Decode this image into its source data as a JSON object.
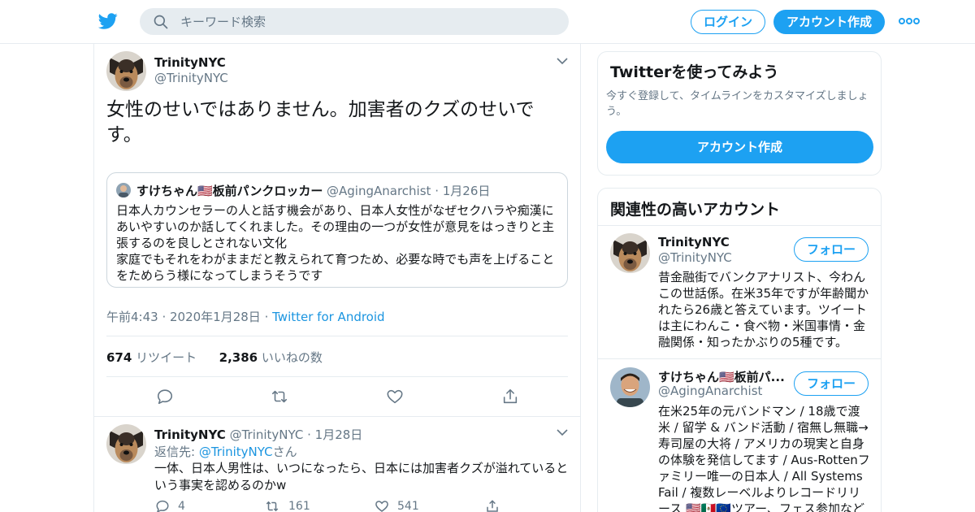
{
  "header": {
    "search_placeholder": "キーワード検索",
    "login_label": "ログイン",
    "signup_label": "アカウント作成"
  },
  "tweet": {
    "author_name": "TrinityNYC",
    "author_handle": "@TrinityNYC",
    "text": "女性のせいではありません。加害者のクズのせいです。",
    "quote": {
      "author_name": "すけちゃん🇺🇸板前パンクロッカー",
      "author_handle": "@AgingAnarchist",
      "date": "1月26日",
      "text_line1": "日本人カウンセラーの人と話す機会があり、日本人女性がなぜセクハラや痴漢にあいやすいのか話してくれました。その理由の一つが女性が意見をはっきりと主張するのを良しとされない文化",
      "text_line2": "家庭でもそれをわがままだと教えられて育つため、必要な時でも声を上げることをためらう様になってしまうそうです"
    },
    "timestamp": "午前4:43 · 2020年1月28日",
    "via": "Twitter for Android",
    "retweet_count": "674",
    "retweet_label": "リツイート",
    "like_count": "2,386",
    "like_label": "いいねの数"
  },
  "reply": {
    "author_name": "TrinityNYC",
    "author_handle": "@TrinityNYC",
    "date": "1月28日",
    "reply_prefix": "返信先: ",
    "reply_to": "@TrinityNYC",
    "reply_suffix": "さん",
    "text": "一体、日本人男性は、いつになったら、日本には加害者クズが溢れているという事実を認めるのかw",
    "reply_count": "4",
    "retweet_count": "161",
    "like_count": "541"
  },
  "sidebar": {
    "signup_card": {
      "title": "Twitterを使ってみよう",
      "subtitle": "今すぐ登録して、タイムラインをカスタマイズしましょう。",
      "button": "アカウント作成"
    },
    "related": {
      "title": "関連性の高いアカウント",
      "follow_label": "フォロー",
      "accounts": [
        {
          "name": "TrinityNYC",
          "handle": "@TrinityNYC",
          "bio": "昔金融街でバンクアナリスト、今わんこの世話係。在米35年ですが年齢聞かれたら26歳と答えています。ツイートは主にわんこ・食べ物・米国事情・金融関係・知ったかぶりの5種です。"
        },
        {
          "name": "すけちゃん🇺🇸板前パ...",
          "handle": "@AgingAnarchist",
          "bio": "在米25年の元バンドマン / 18歳で渡米 / 留学 & バンド活動 / 宿無し無職→寿司屋の大将 / アメリカの現実と自身の体験を発信してます / Aus-Rottenファミリー唯一の日本人 / All Systems Fail / 複数レーベルよりレコードリリース 🇺🇸🇲🇽🇪🇺ツアー、フェス参加など一通"
        }
      ]
    }
  },
  "colors": {
    "brand": "#1da1f2",
    "link": "#1b95e0",
    "secondary_text": "#657786",
    "border": "#e6ecf0"
  }
}
